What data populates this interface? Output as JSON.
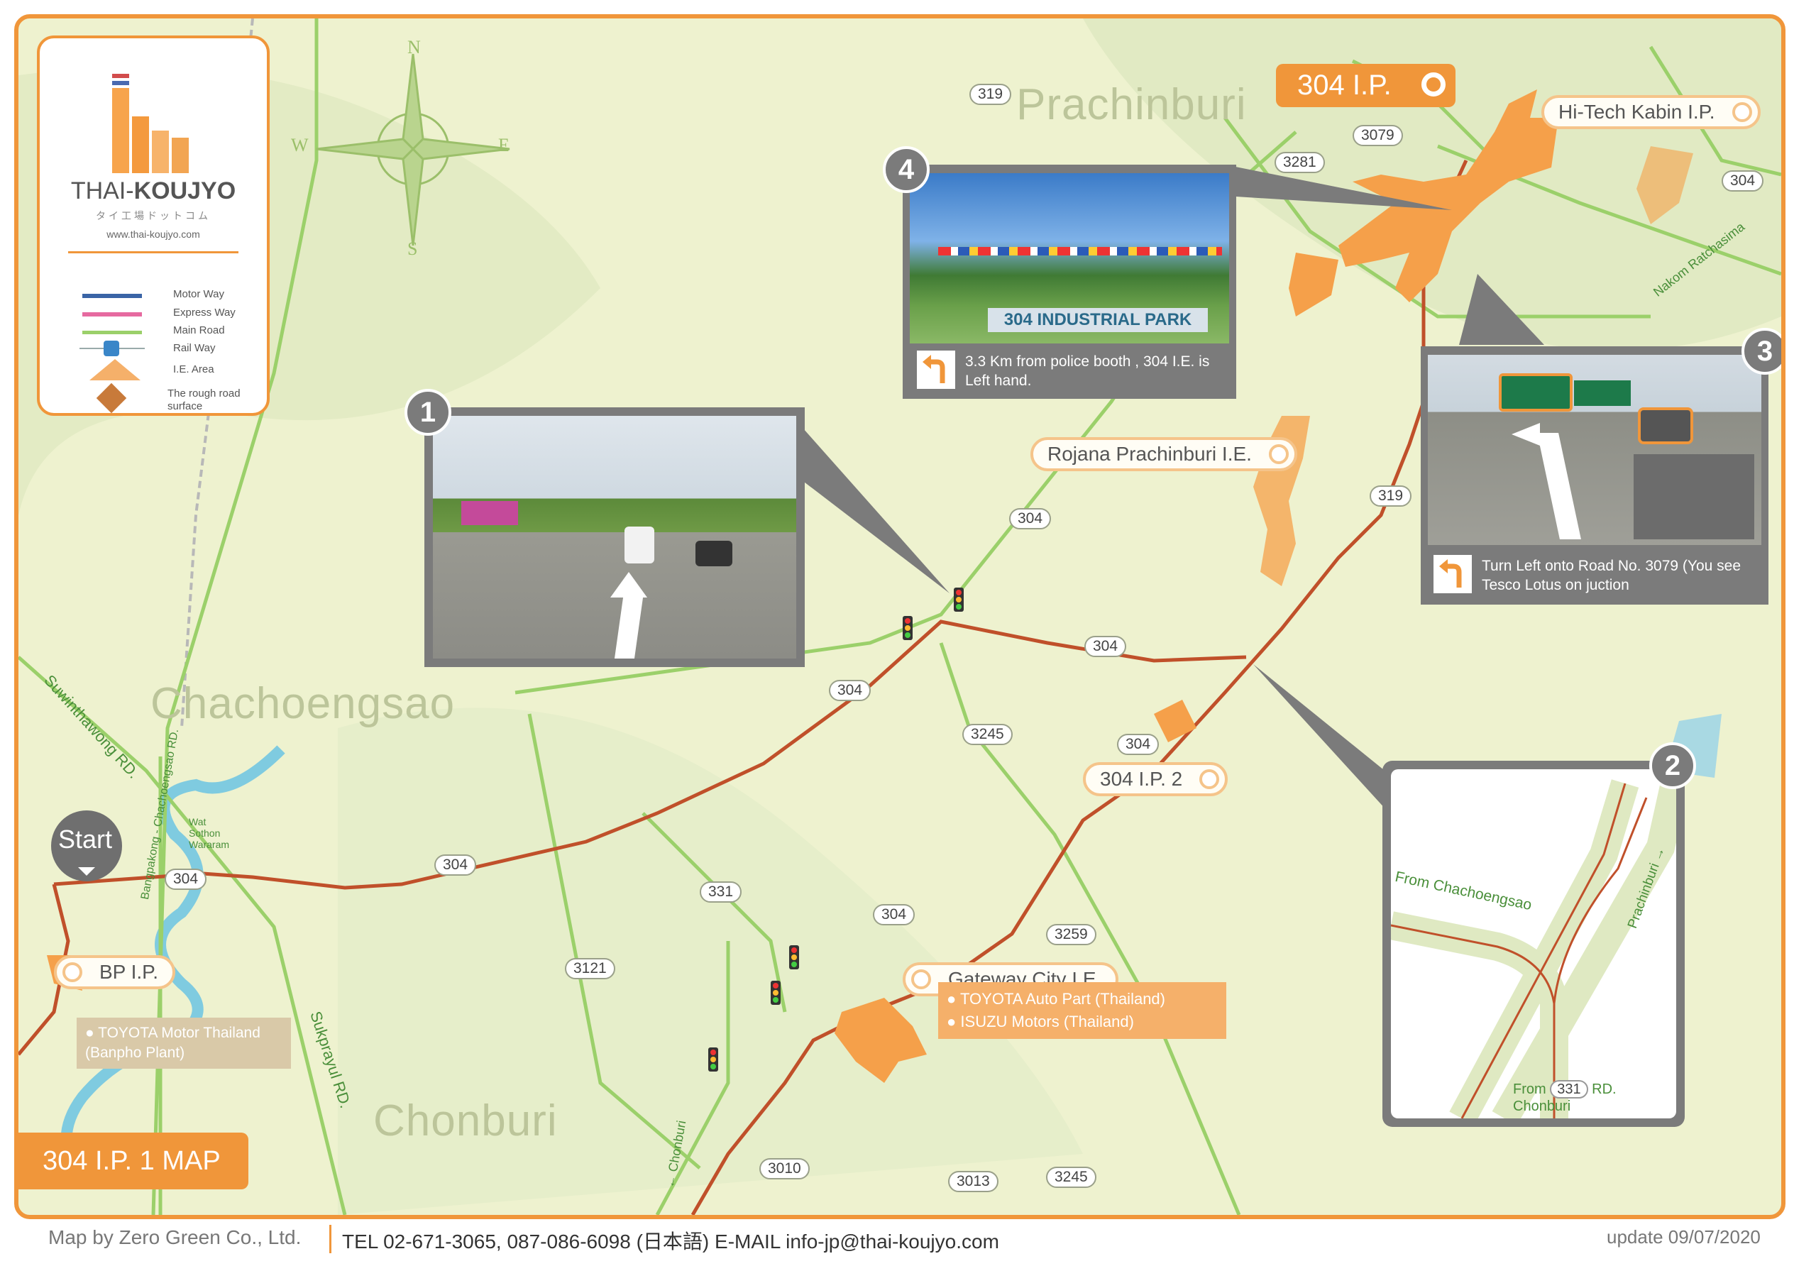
{
  "brand": {
    "name_plain": "THAI-",
    "name_bold": "KOUJYO",
    "name_jp": "タイ工場ドットコム",
    "url": "www.thai-koujyo.com"
  },
  "legend": {
    "items": [
      {
        "label": "Motor Way",
        "color": "#3a64a6"
      },
      {
        "label": "Express Way",
        "color": "#e66aa0"
      },
      {
        "label": "Main Road",
        "color": "#9bd06a"
      },
      {
        "label": "Rail Way",
        "icon": "rail-icon"
      },
      {
        "label": "I.E. Area",
        "icon": "ie-area-icon"
      },
      {
        "label": "The rough road surface",
        "icon": "rough-road-icon"
      }
    ]
  },
  "compass": {
    "n": "N",
    "s": "S",
    "e": "E",
    "w": "W"
  },
  "regions": {
    "prachinburi": "Prachinburi",
    "chachoengsao": "Chachoengsao",
    "chonburi": "Chonburi"
  },
  "road_numbers": [
    "319",
    "3079",
    "3281",
    "304",
    "304",
    "319",
    "304",
    "304",
    "3245",
    "304",
    "304",
    "304",
    "331",
    "3259",
    "3121",
    "3010",
    "3013",
    "3245"
  ],
  "road_names": {
    "suwinthawong": "Suwinthawong RD.",
    "sukprayul": "Sukprayul RD.",
    "bangpakong": "Bangpakong - Chachoengsao RD.",
    "nakom": "Nakom Ratchasima",
    "chonburi_arrow": "← Chonburi",
    "wat_sothon": "Wat Sothon Wararam"
  },
  "industrial_estates": {
    "ip304": "304 I.P.",
    "hitech": "Hi-Tech Kabin I.P.",
    "rojana": "Rojana Prachinburi I.E.",
    "ip304_2": "304 I.P. 2",
    "gateway": "Gateway City I.E.",
    "bp": "BP I.P."
  },
  "gateway_companies": [
    "TOYOTA Auto Part (Thailand)",
    "ISUZU Motors (Thailand)"
  ],
  "bp_companies": [
    "TOYOTA Motor Thailand (Banpho Plant)"
  ],
  "start_label": "Start",
  "map_title": "304 I.P. 1 MAP",
  "callouts": {
    "c1": {
      "num": "1"
    },
    "c2": {
      "num": "2",
      "from_left": "From Chachoengsao",
      "prachinburi": "Prachinburi →",
      "from_bottom_pre": "From",
      "from_bottom_road": "331",
      "from_bottom_post": "RD.",
      "from_bottom_town": "Chonburi"
    },
    "c3": {
      "num": "3",
      "caption": "Turn Left onto Road No. 3079 (You see Tesco Lotus on juction"
    },
    "c4": {
      "num": "4",
      "caption": "3.3 Km from police booth , 304 I.E. is Left hand.",
      "sign": "304 INDUSTRIAL PARK"
    }
  },
  "footer": {
    "credit": "Map by Zero Green Co., Ltd.",
    "contact": "TEL 02-671-3065, 087-086-6098 (日本語) E-MAIL info-jp@thai-koujyo.com",
    "update": "update 09/07/2020"
  },
  "colors": {
    "frame": "#f0963a",
    "land": "#eef2cf",
    "route": "#c0502a",
    "main_road": "#9bd06a",
    "ie_area": "#f5a04a"
  }
}
